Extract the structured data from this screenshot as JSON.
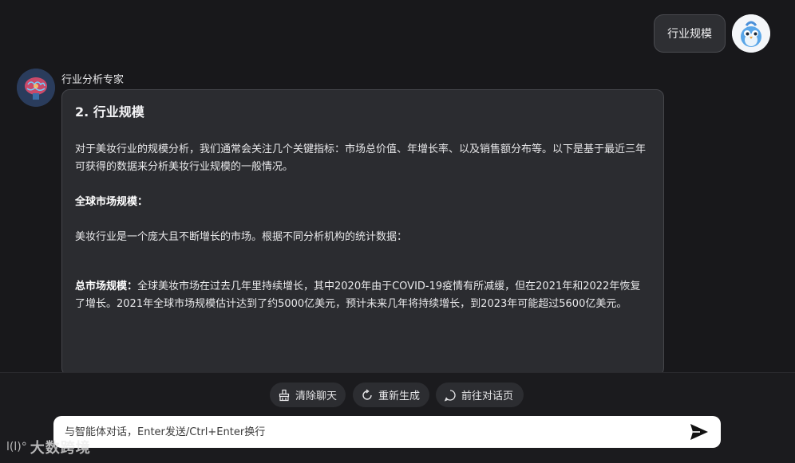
{
  "user_message": {
    "text": "行业规模"
  },
  "bot": {
    "name": "行业分析专家",
    "heading": "2. 行业规模",
    "intro": "对于美妆行业的规模分析，我们通常会关注几个关键指标：市场总价值、年增长率、以及销售额分布等。以下是基于最近三年可获得的数据来分析美妆行业规模的一般情况。",
    "section_title": "全球市场规模：",
    "section_body": "美妆行业是一个庞大且不断增长的市场。根据不同分析机构的统计数据：",
    "bullet_label": "总市场规模：",
    "bullet_body": "全球美妆市场在过去几年里持续增长，其中2020年由于COVID-19疫情有所减缓，但在2021年和2022年恢复了增长。2021年全球市场规模估计达到了约5000亿美元，预计未来几年将持续增长，到2023年可能超过5600亿美元。"
  },
  "actions": {
    "clear": "清除聊天",
    "regenerate": "重新生成",
    "goto_chat": "前往对话页"
  },
  "input": {
    "placeholder": "与智能体对话，Enter发送/Ctrl+Enter换行"
  },
  "watermark": {
    "logo": "l(l)°",
    "text": "大数跨境"
  }
}
